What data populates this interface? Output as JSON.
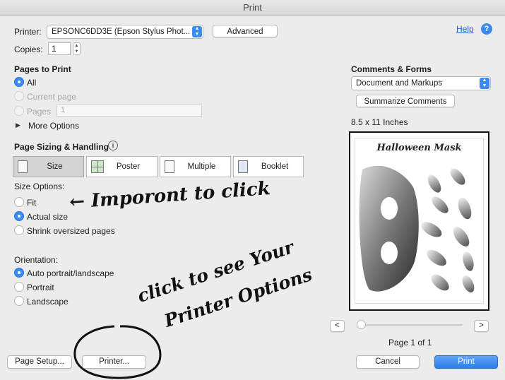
{
  "window": {
    "title": "Print"
  },
  "printer": {
    "label": "Printer:",
    "value": "EPSONC6DD3E (Epson Stylus Phot...",
    "advanced": "Advanced"
  },
  "help": {
    "label": "Help"
  },
  "copies": {
    "label": "Copies:",
    "value": "1"
  },
  "pages_to_print": {
    "heading": "Pages to Print",
    "all": "All",
    "current_page": "Current page",
    "pages": "Pages",
    "pages_value": "1",
    "more_options": "More Options"
  },
  "sizing": {
    "heading": "Page Sizing & Handling",
    "tabs": [
      "Size",
      "Poster",
      "Multiple",
      "Booklet"
    ],
    "size_options_label": "Size Options:",
    "fit": "Fit",
    "actual_size": "Actual size",
    "shrink": "Shrink oversized pages"
  },
  "orientation": {
    "label": "Orientation:",
    "auto": "Auto portrait/landscape",
    "portrait": "Portrait",
    "landscape": "Landscape"
  },
  "comments": {
    "heading": "Comments & Forms",
    "value": "Document and Markups",
    "summarize": "Summarize Comments"
  },
  "preview": {
    "paper_size": "8.5 x 11 Inches",
    "doc_title": "Halloween Mask",
    "prev": "<",
    "next": ">",
    "page_label": "Page 1 of 1",
    "slider_fraction": 0
  },
  "annotations": {
    "note1": "← Imporont to click",
    "note2_line1": "click to see Your",
    "note2_line2": "Printer Options"
  },
  "footer": {
    "page_setup": "Page Setup...",
    "printer": "Printer...",
    "cancel": "Cancel",
    "print": "Print"
  },
  "colors": {
    "accent": "#3a8bf0"
  }
}
